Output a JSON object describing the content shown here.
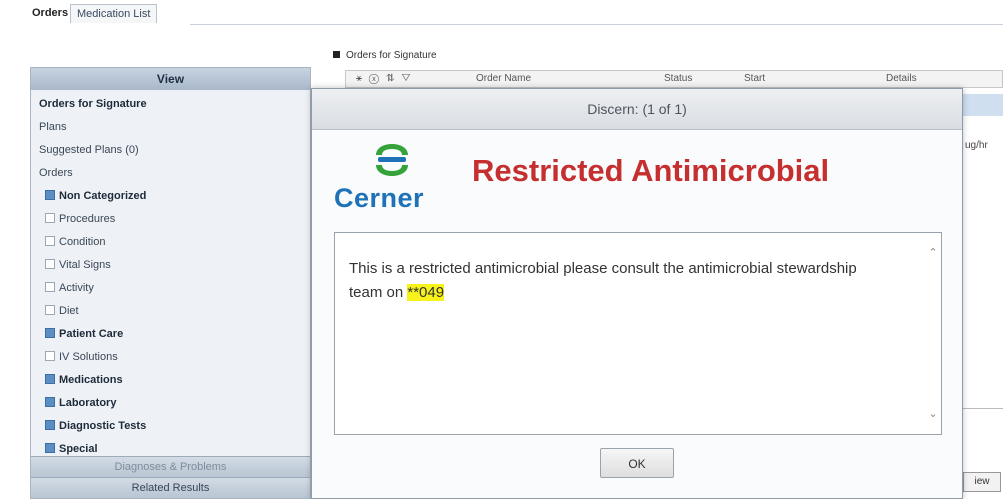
{
  "tabs": {
    "active": "Orders",
    "other": "Medication List"
  },
  "nav": {
    "header": "View",
    "items": [
      {
        "label": "Orders for Signature",
        "bold": true,
        "level": 0,
        "checkbox": null
      },
      {
        "label": "Plans",
        "bold": false,
        "level": 0,
        "checkbox": null
      },
      {
        "label": "Suggested Plans (0)",
        "bold": false,
        "level": 0,
        "checkbox": null
      },
      {
        "label": "Orders",
        "bold": false,
        "level": 0,
        "checkbox": null
      },
      {
        "label": "Non Categorized",
        "bold": true,
        "level": 1,
        "checkbox": true
      },
      {
        "label": "Procedures",
        "bold": false,
        "level": 1,
        "checkbox": false
      },
      {
        "label": "Condition",
        "bold": false,
        "level": 1,
        "checkbox": false
      },
      {
        "label": "Vital Signs",
        "bold": false,
        "level": 1,
        "checkbox": false
      },
      {
        "label": "Activity",
        "bold": false,
        "level": 1,
        "checkbox": false
      },
      {
        "label": "Diet",
        "bold": false,
        "level": 1,
        "checkbox": false
      },
      {
        "label": "Patient Care",
        "bold": true,
        "level": 1,
        "checkbox": true
      },
      {
        "label": "IV Solutions",
        "bold": false,
        "level": 1,
        "checkbox": false
      },
      {
        "label": "Medications",
        "bold": true,
        "level": 1,
        "checkbox": true
      },
      {
        "label": "Laboratory",
        "bold": true,
        "level": 1,
        "checkbox": true
      },
      {
        "label": "Diagnostic Tests",
        "bold": true,
        "level": 1,
        "checkbox": true
      },
      {
        "label": "Special",
        "bold": true,
        "level": 1,
        "checkbox": true
      }
    ],
    "bottom": {
      "diagnoses": "Diagnoses & Problems",
      "related": "Related Results"
    }
  },
  "orders_panel": {
    "title": "Orders for Signature",
    "grid_icons": "⚹ ⓧ ⇅ ▽",
    "columns": {
      "name": "Order Name",
      "status": "Status",
      "start": "Start",
      "details": "Details"
    },
    "right_fragment": "ug/hr",
    "bottom_fragment": "iew"
  },
  "dialog": {
    "title": "Discern: (1 of 1)",
    "logo_text": "Cerner",
    "heading": "Restricted Antimicrobial",
    "message_prefix": "This is a restricted antimicrobial please consult the antimicrobial stewardship team on ",
    "message_highlight": "**049",
    "ok_label": "OK",
    "scroll_up": "⌃",
    "scroll_down": "⌄"
  },
  "colors": {
    "heading_red": "#c62f2f",
    "logo_blue": "#1d72b8",
    "logo_green": "#36a23c",
    "highlight": "#f6f21a"
  }
}
